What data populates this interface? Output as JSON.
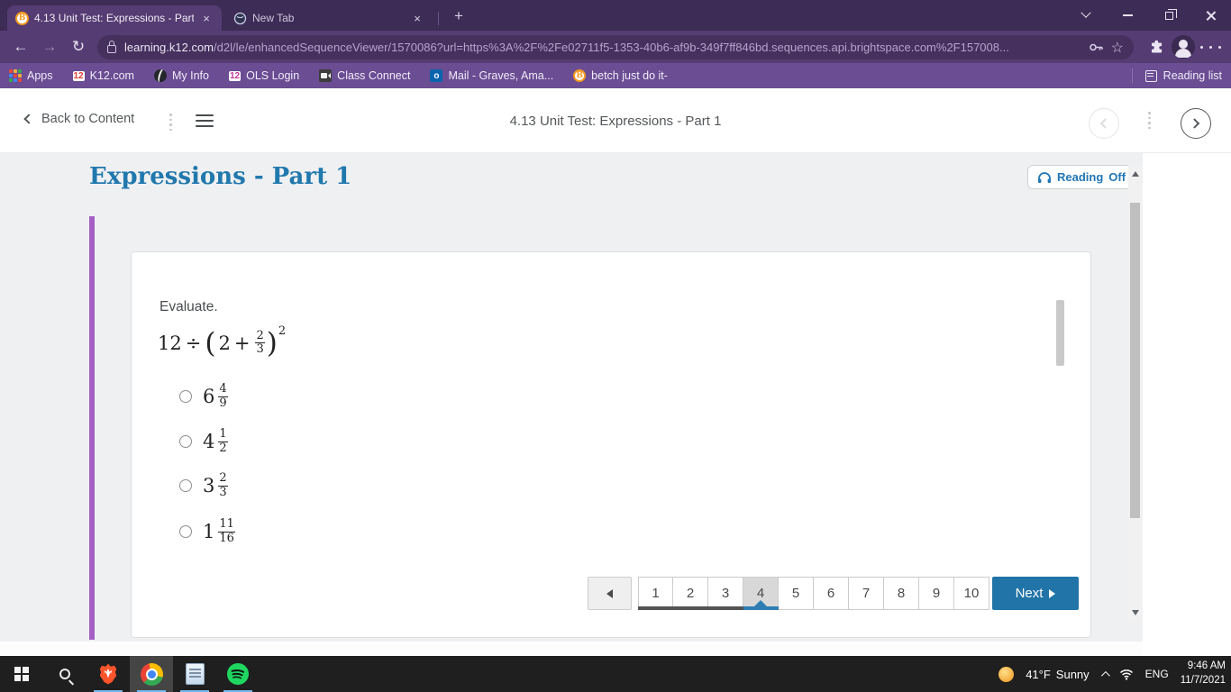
{
  "browser": {
    "tab1_title": "4.13 Unit Test: Expressions - Part",
    "tab2_title": "New Tab",
    "url_host": "learning.k12.com",
    "url_path": "/d2l/le/enhancedSequenceViewer/1570086?url=https%3A%2F%2Fe02711f5-1353-40b6-af9b-349f7ff846bd.sequences.api.brightspace.com%2F157008...",
    "bookmarks": {
      "apps": "Apps",
      "k12": "K12.com",
      "myinfo": "My Info",
      "ols": "OLS Login",
      "class_connect": "Class Connect",
      "mail": "Mail - Graves, Ama...",
      "betch": "betch just do it-",
      "reading_list": "Reading list"
    }
  },
  "header": {
    "back": "Back to Content",
    "title": "4.13 Unit Test: Expressions - Part 1"
  },
  "page": {
    "title": "Expressions - Part 1",
    "reading": "Reading",
    "reading_state": "Off"
  },
  "question": {
    "prompt": "Evaluate.",
    "expr": {
      "left": "12",
      "op": "÷",
      "open": "(",
      "a": "2",
      "plus": "+",
      "num": "2",
      "den": "3",
      "close": ")",
      "exp": "2"
    },
    "options": [
      {
        "whole": "6",
        "num": "4",
        "den": "9"
      },
      {
        "whole": "4",
        "num": "1",
        "den": "2"
      },
      {
        "whole": "3",
        "num": "2",
        "den": "3"
      },
      {
        "whole": "1",
        "num": "11",
        "den": "16"
      }
    ]
  },
  "pagination": {
    "pages": [
      "1",
      "2",
      "3",
      "4",
      "5",
      "6",
      "7",
      "8",
      "9",
      "10"
    ],
    "current": "4",
    "next": "Next"
  },
  "taskbar": {
    "temp": "41°F",
    "weather": "Sunny",
    "lang": "ENG",
    "time": "9:46 AM",
    "date": "11/7/2021"
  }
}
